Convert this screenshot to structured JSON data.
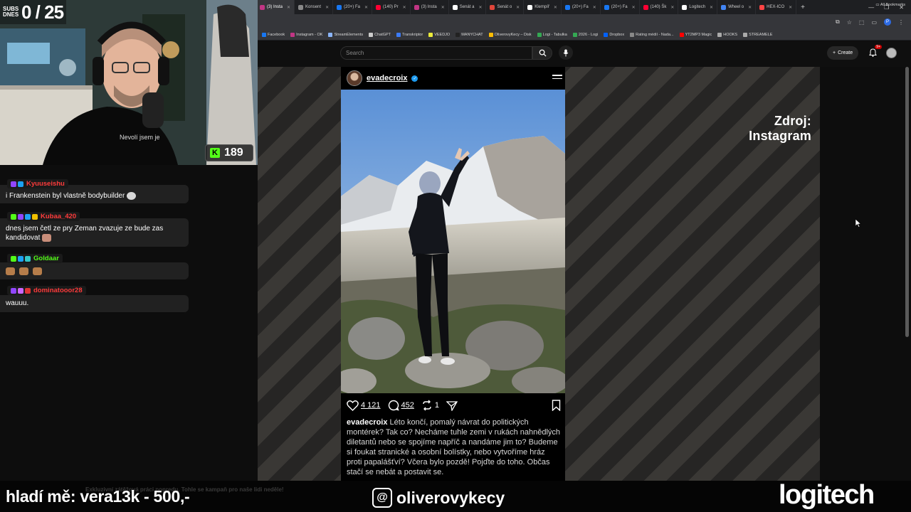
{
  "browser": {
    "tabs": [
      {
        "label": "(3) Insta",
        "color": "#c13584"
      },
      {
        "label": "Konsent",
        "color": "#888888"
      },
      {
        "label": "(20+) Fa",
        "color": "#1877f2"
      },
      {
        "label": "(140) Pr",
        "color": "#ff0033"
      },
      {
        "label": "(3) Insta",
        "color": "#c13584"
      },
      {
        "label": "Senát a",
        "color": "#ffffff"
      },
      {
        "label": "Senát o",
        "color": "#e0453a"
      },
      {
        "label": "Klempíř",
        "color": "#ffffff"
      },
      {
        "label": "(20+) Fa",
        "color": "#1877f2"
      },
      {
        "label": "(20+) Fa",
        "color": "#1877f2"
      },
      {
        "label": "(140) Šk",
        "color": "#ff0033"
      },
      {
        "label": "Logitech",
        "color": "#ffffff"
      },
      {
        "label": "Wheel o",
        "color": "#4285f4"
      },
      {
        "label": "HEX-ICO",
        "color": "#ff4444"
      }
    ],
    "profile_letter": "P",
    "bookmarks": [
      {
        "label": "Facebook",
        "color": "#1877f2"
      },
      {
        "label": "Instagram - OK",
        "color": "#c13584"
      },
      {
        "label": "StreamElements",
        "color": "#8ab4f8"
      },
      {
        "label": "ChatGPT",
        "color": "#cccccc"
      },
      {
        "label": "Transkriptor",
        "color": "#3c7bf6"
      },
      {
        "label": "VEEDJO",
        "color": "#eaea3a"
      },
      {
        "label": "MANYCHAT",
        "color": "#222222"
      },
      {
        "label": "OliverovyKecy – Disk",
        "color": "#fbbc04"
      },
      {
        "label": "Logi - Tabulka",
        "color": "#34a853"
      },
      {
        "label": "2026 - Logi",
        "color": "#34a853"
      },
      {
        "label": "Dropbox",
        "color": "#0061ff"
      },
      {
        "label": "Rating médií - Nada...",
        "color": "#888888"
      },
      {
        "label": "YT2MP3 Magic",
        "color": "#ff0000"
      },
      {
        "label": "HOOKS",
        "color": "#aaaaaa"
      },
      {
        "label": "STREAMELE",
        "color": "#aaaaaa"
      }
    ],
    "all_bookmarks": "All Bookmarks"
  },
  "site": {
    "search_placeholder": "Search",
    "create_label": "Create",
    "notif_badge": "9+"
  },
  "overlay": {
    "subs_label": "SUBS DNES",
    "subs_count": "0 / 25",
    "kick_count": "189",
    "source_label": "Zdroj: Instagram"
  },
  "post": {
    "username": "evadecroix",
    "likes": "4 121",
    "comments": "452",
    "reposts": "1",
    "caption_user": "evadecroix",
    "caption": "Léto končí, pomalý návrat do politických montérek? Tak co? Necháme tuhle zemi v rukách nahnědlých diletantů nebo se spojíme napříč a nandáme jim to? Budeme si foukat stranické a osobní bolístky, nebo vytvoříme hráz proti papalášťví? Včera bylo pozdě! Pojďte do toho. Občas stačí se nebát a postavit se."
  },
  "chat": [
    {
      "user": "Kyuuseishu",
      "color": "#ff3b3b",
      "badges": [
        "#9146ff",
        "#1da1f2"
      ],
      "text": "i Frankenstein byl vlastně bodybuilder",
      "emotes": 1
    },
    {
      "user": "Kubaa_420",
      "color": "#ff3b3b",
      "badges": [
        "#53fc18",
        "#9146ff",
        "#1da1f2",
        "#f0c000"
      ],
      "text": "dnes jsem četl ze pry Zeman zvazuje ze bude zas",
      "text2": "kandidovat",
      "emotes": 1
    },
    {
      "user": "Goldaar",
      "color": "#53fc18",
      "badges": [
        "#53fc18",
        "#1da1f2",
        "#34c7c7"
      ],
      "text": "",
      "emotes": 3
    },
    {
      "user": "dominatooor28",
      "color": "#ff3b3b",
      "badges": [
        "#9146ff",
        "#cc66ff",
        "#dd3333"
      ],
      "text": "wauuu.",
      "emotes": 0
    }
  ],
  "bottom": {
    "donation_text": "hladí mě: vera13k - 500,-",
    "faint_text": "Exkluzivní zátěžová práci popredu. Tohle se kampaň pro naše lidi neděle!",
    "threads_handle": "oliverovykecy",
    "sponsor": "logitech"
  }
}
